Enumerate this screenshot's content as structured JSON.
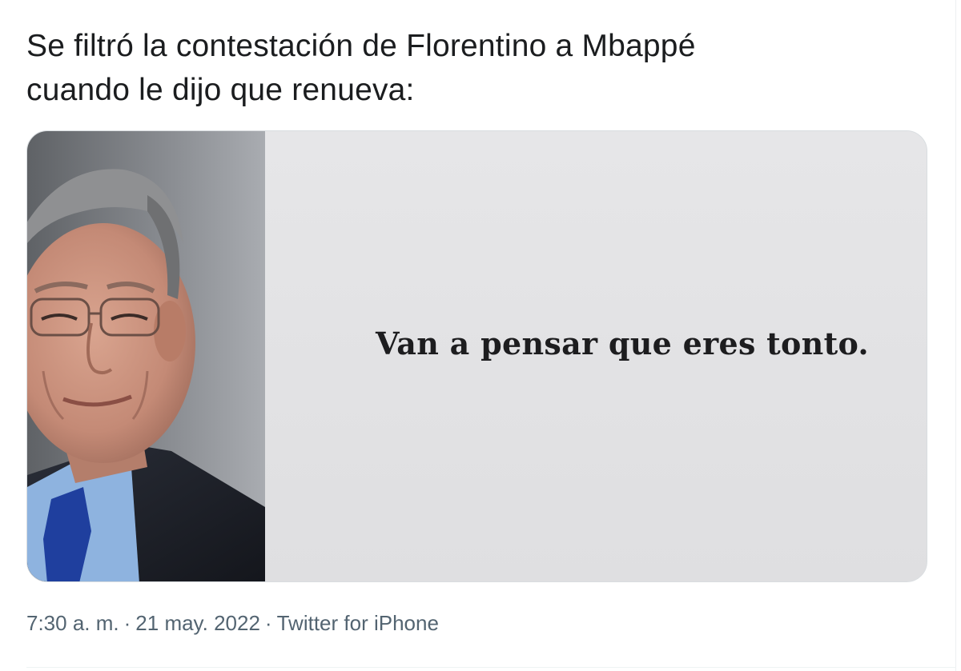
{
  "tweet": {
    "text_line1": "Se filtró la contestación de Florentino a Mbappé",
    "text_line2": "cuando le dijo que renueva:",
    "media": {
      "caption": "Van a pensar que eres tonto."
    },
    "meta": {
      "time": "7:30 a. m.",
      "date": "21 may. 2022",
      "source": "Twitter for iPhone",
      "separator": "·"
    }
  },
  "colors": {
    "text": "#0f1419",
    "meta_text": "#536471",
    "media_border": "#d9dde0",
    "caption_background": "#e4e4e6",
    "tie_blue": "#1f3f9e",
    "suit_dark": "#1e2129"
  }
}
